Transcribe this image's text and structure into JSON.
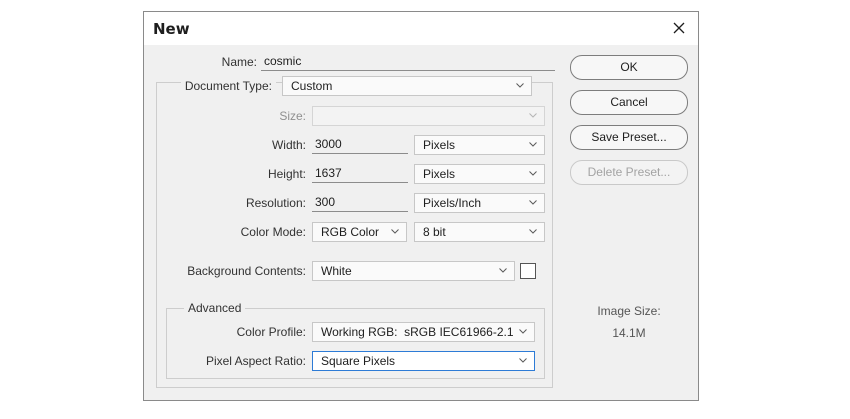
{
  "dialog": {
    "title": "New"
  },
  "name": {
    "label": "Name:",
    "value": "cosmic"
  },
  "document_type": {
    "label": "Document Type:",
    "value": "Custom"
  },
  "size": {
    "label": "Size:",
    "value": ""
  },
  "width": {
    "label": "Width:",
    "value": "3000",
    "unit": "Pixels"
  },
  "height": {
    "label": "Height:",
    "value": "1637",
    "unit": "Pixels"
  },
  "resolution": {
    "label": "Resolution:",
    "value": "300",
    "unit": "Pixels/Inch"
  },
  "color_mode": {
    "label": "Color Mode:",
    "value": "RGB Color",
    "depth": "8 bit"
  },
  "background": {
    "label": "Background Contents:",
    "value": "White",
    "swatch_color": "#ffffff"
  },
  "advanced": {
    "title": "Advanced",
    "color_profile": {
      "label": "Color Profile:",
      "value": "Working RGB:  sRGB IEC61966-2.1"
    },
    "pixel_aspect": {
      "label": "Pixel Aspect Ratio:",
      "value": "Square Pixels"
    }
  },
  "buttons": {
    "ok": "OK",
    "cancel": "Cancel",
    "save_preset": "Save Preset...",
    "delete_preset": "Delete Preset..."
  },
  "image_size": {
    "label": "Image Size:",
    "value": "14.1M"
  },
  "colors": {
    "focus": "#2d7bd6",
    "dialog_bg": "#f0f0f0"
  }
}
